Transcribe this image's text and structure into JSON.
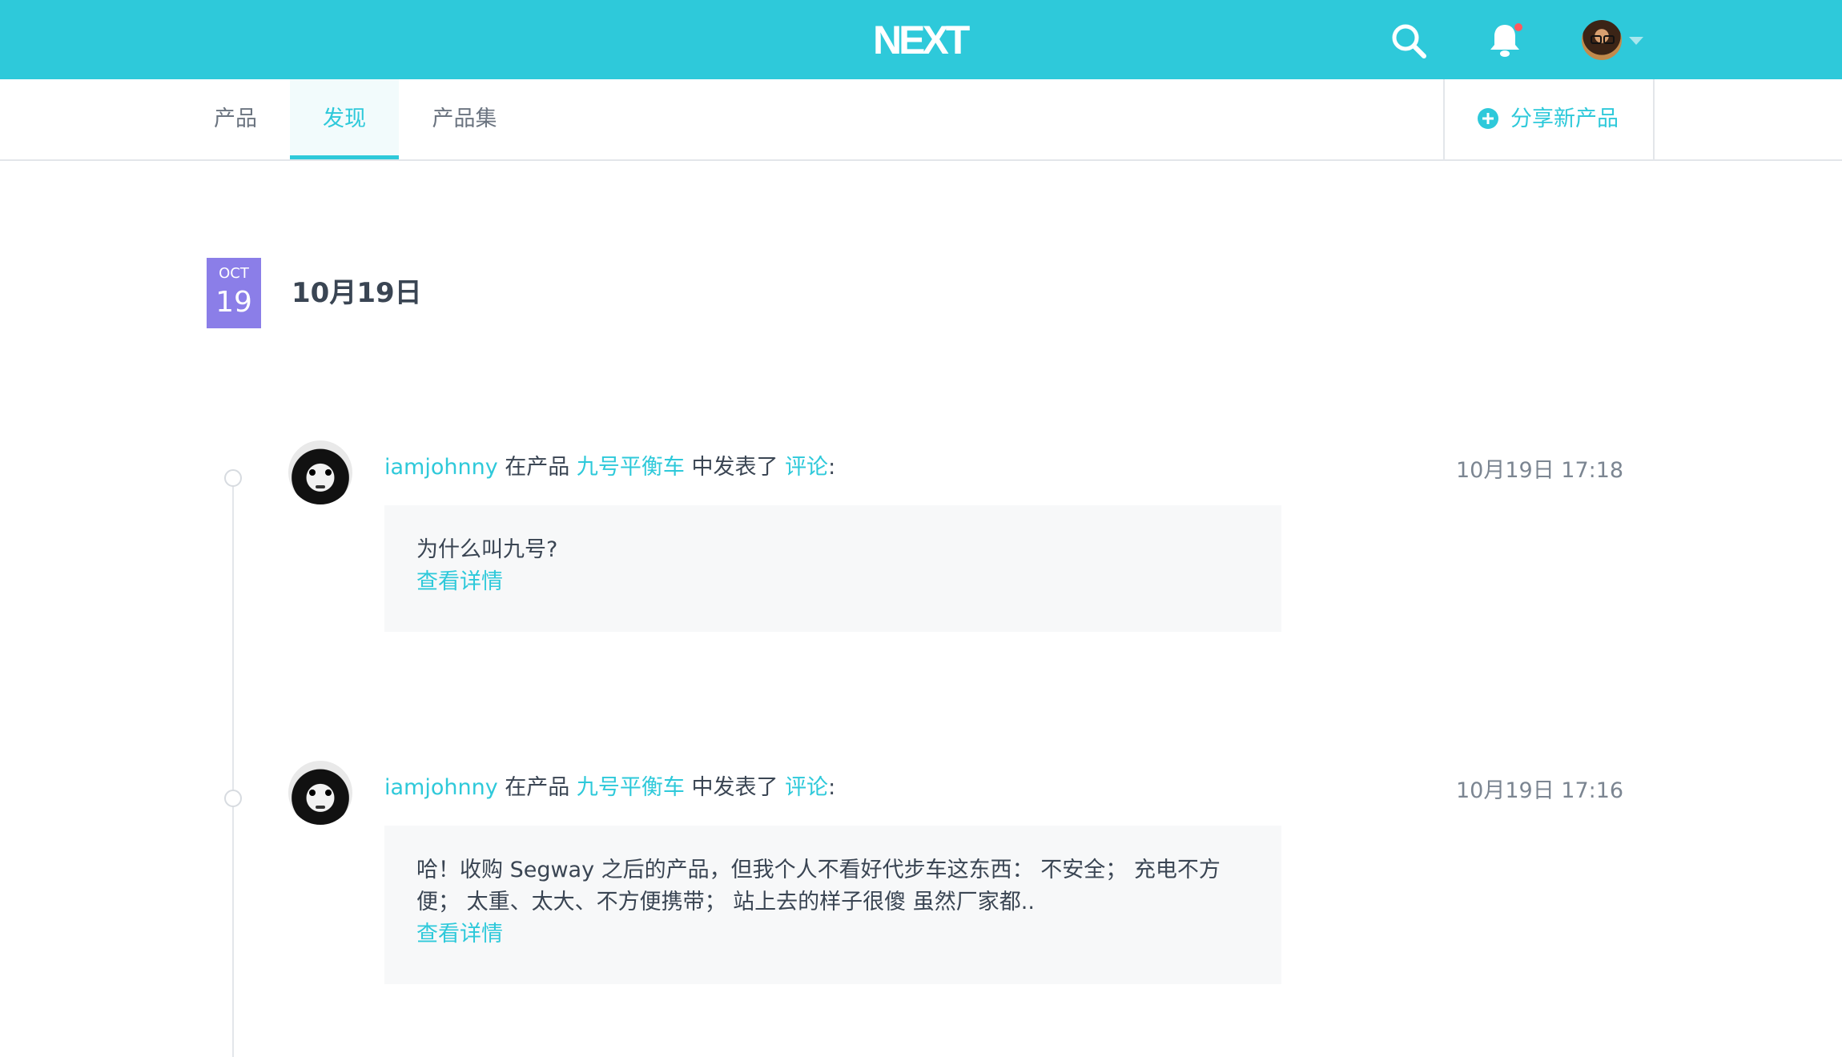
{
  "header": {
    "logo_text": "NEXT",
    "brand_color": "#2ec9da",
    "icons": [
      "search-icon",
      "bell-icon",
      "user-avatar",
      "chevron-down-icon"
    ]
  },
  "nav": {
    "tabs": [
      {
        "label": "产品"
      },
      {
        "label": "发现",
        "active": true
      },
      {
        "label": "产品集"
      }
    ],
    "share_label": "分享新产品"
  },
  "date_group": {
    "month": "OCT",
    "day": "19",
    "title": "10月19日"
  },
  "entries": [
    {
      "user": "iamjohnny",
      "prefix": "在产品",
      "product": "九号平衡车",
      "action": "中发表了",
      "type": "评论",
      "colon": ":",
      "time": "10月19日 17:18",
      "comment": "为什么叫九号?",
      "more": "查看详情"
    },
    {
      "user": "iamjohnny",
      "prefix": "在产品",
      "product": "九号平衡车",
      "action": "中发表了",
      "type": "评论",
      "colon": ":",
      "time": "10月19日 17:16",
      "comment_line1": "哈！收购 Segway 之后的产品，但我个人不看好代步车这东西： 不安全； 充电不方",
      "comment_line2": "便； 太重、太大、不方便携带； 站上去的样子很傻 虽然厂家都..",
      "more": "查看详情"
    }
  ]
}
